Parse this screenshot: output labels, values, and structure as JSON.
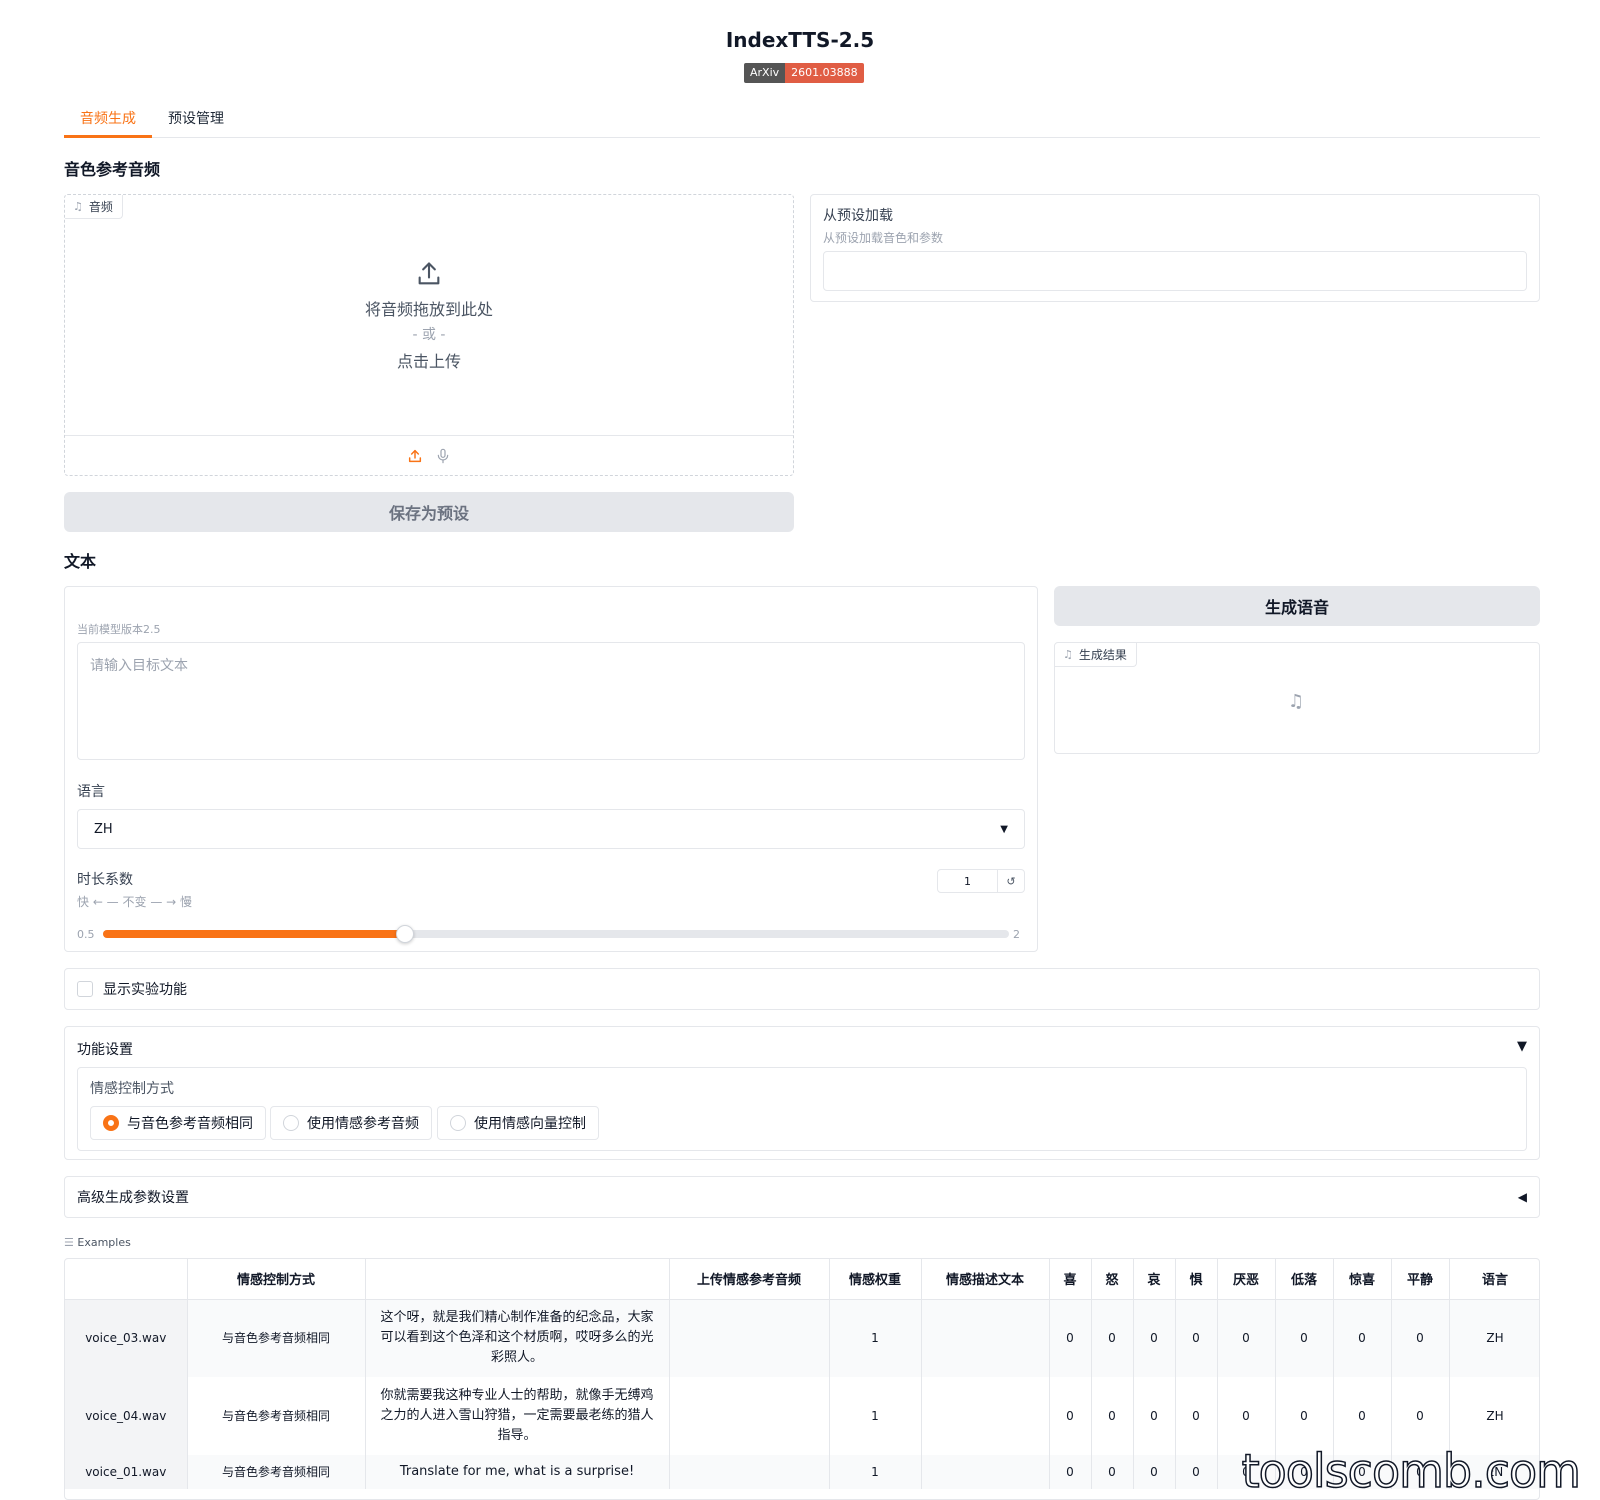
{
  "header": {
    "title": "IndexTTS-2.5",
    "badge_left": "ArXiv",
    "badge_right": "2601.03888"
  },
  "tabs": [
    {
      "label": "音频生成",
      "active": true
    },
    {
      "label": "预设管理",
      "active": false
    }
  ],
  "voice_ref": {
    "section_title": "音色参考音频",
    "chip_label": "音频",
    "drop_text": "将音频拖放到此处",
    "or_text": "- 或 -",
    "click_text": "点击上传",
    "save_button": "保存为预设"
  },
  "preset": {
    "label": "从预设加载",
    "info": "从预设加载音色和参数",
    "value": ""
  },
  "text_section": {
    "title": "文本",
    "model_info": "当前模型版本2.5",
    "placeholder": "请输入目标文本",
    "lang_label": "语言",
    "lang_value": "ZH",
    "duration_label": "时长系数",
    "duration_info": "快 ← — 不变 — → 慢",
    "duration_value": "1",
    "slider_min": "0.5",
    "slider_max": "2",
    "slider_value": 1
  },
  "generate": {
    "button": "生成语音",
    "result_label": "生成结果"
  },
  "experimental": {
    "label": "显示实验功能",
    "checked": false
  },
  "features": {
    "title": "功能设置",
    "arrow": "▼",
    "emotion_label": "情感控制方式",
    "options": [
      "与音色参考音频相同",
      "使用情感参考音频",
      "使用情感向量控制"
    ],
    "selected_index": 0
  },
  "advanced": {
    "title": "高级生成参数设置",
    "arrow": "◀"
  },
  "examples": {
    "label": "Examples",
    "headers": [
      "",
      "情感控制方式",
      "",
      "上传情感参考音频",
      "情感权重",
      "情感描述文本",
      "喜",
      "怒",
      "哀",
      "惧",
      "厌恶",
      "低落",
      "惊喜",
      "平静",
      "语言"
    ],
    "rows": [
      [
        "voice_03.wav",
        "与音色参考音频相同",
        "这个呀，就是我们精心制作准备的纪念品，大家可以看到这个色泽和这个材质啊，哎呀多么的光彩照人。",
        "",
        "1",
        "",
        "0",
        "0",
        "0",
        "0",
        "0",
        "0",
        "0",
        "0",
        "ZH"
      ],
      [
        "voice_04.wav",
        "与音色参考音频相同",
        "你就需要我这种专业人士的帮助，就像手无缚鸡之力的人进入雪山狩猎，一定需要最老练的猎人指导。",
        "",
        "1",
        "",
        "0",
        "0",
        "0",
        "0",
        "0",
        "0",
        "0",
        "0",
        "ZH"
      ],
      [
        "voice_01.wav",
        "与音色参考音频相同",
        "Translate for me, what is a surprise!",
        "",
        "1",
        "",
        "0",
        "0",
        "0",
        "0",
        "0",
        "0",
        "0",
        "0",
        "EN"
      ]
    ]
  },
  "watermark": "toolscomb.com",
  "colors": {
    "accent": "#f97316",
    "badge_right": "#e05d44"
  }
}
